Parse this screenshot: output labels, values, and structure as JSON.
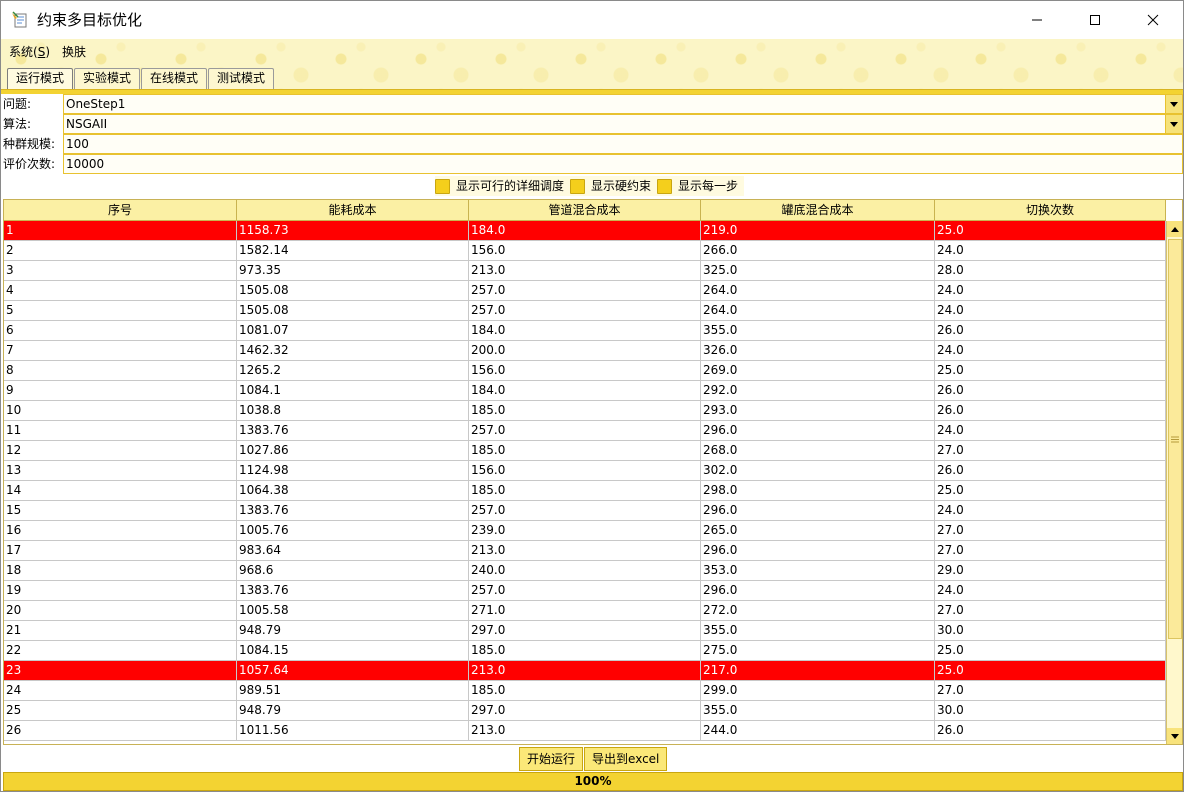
{
  "window": {
    "title": "约束多目标优化"
  },
  "menu": [
    {
      "label": "系统(",
      "mnemonic": "S",
      "suffix": ")"
    },
    {
      "label": "换肤"
    }
  ],
  "tabs": [
    "运行模式",
    "实验模式",
    "在线模式",
    "测试模式"
  ],
  "form": {
    "problem_label": "问题:",
    "problem_value": "OneStep1",
    "algorithm_label": "算法:",
    "algorithm_value": "NSGAII",
    "population_label": "种群规模:",
    "population_value": "100",
    "evaluations_label": "评价次数:",
    "evaluations_value": "10000"
  },
  "checkboxes": [
    "显示可行的详细调度",
    "显示硬约束",
    "显示每一步"
  ],
  "table": {
    "columns": [
      "序号",
      "能耗成本",
      "管道混合成本",
      "罐底混合成本",
      "切换次数"
    ],
    "rows": [
      {
        "cells": [
          "1",
          "1158.73",
          "184.0",
          "219.0",
          "25.0"
        ],
        "highlight": true
      },
      {
        "cells": [
          "2",
          "1582.14",
          "156.0",
          "266.0",
          "24.0"
        ]
      },
      {
        "cells": [
          "3",
          "973.35",
          "213.0",
          "325.0",
          "28.0"
        ]
      },
      {
        "cells": [
          "4",
          "1505.08",
          "257.0",
          "264.0",
          "24.0"
        ]
      },
      {
        "cells": [
          "5",
          "1505.08",
          "257.0",
          "264.0",
          "24.0"
        ]
      },
      {
        "cells": [
          "6",
          "1081.07",
          "184.0",
          "355.0",
          "26.0"
        ]
      },
      {
        "cells": [
          "7",
          "1462.32",
          "200.0",
          "326.0",
          "24.0"
        ]
      },
      {
        "cells": [
          "8",
          "1265.2",
          "156.0",
          "269.0",
          "25.0"
        ]
      },
      {
        "cells": [
          "9",
          "1084.1",
          "184.0",
          "292.0",
          "26.0"
        ]
      },
      {
        "cells": [
          "10",
          "1038.8",
          "185.0",
          "293.0",
          "26.0"
        ]
      },
      {
        "cells": [
          "11",
          "1383.76",
          "257.0",
          "296.0",
          "24.0"
        ]
      },
      {
        "cells": [
          "12",
          "1027.86",
          "185.0",
          "268.0",
          "27.0"
        ]
      },
      {
        "cells": [
          "13",
          "1124.98",
          "156.0",
          "302.0",
          "26.0"
        ]
      },
      {
        "cells": [
          "14",
          "1064.38",
          "185.0",
          "298.0",
          "25.0"
        ]
      },
      {
        "cells": [
          "15",
          "1383.76",
          "257.0",
          "296.0",
          "24.0"
        ]
      },
      {
        "cells": [
          "16",
          "1005.76",
          "239.0",
          "265.0",
          "27.0"
        ]
      },
      {
        "cells": [
          "17",
          "983.64",
          "213.0",
          "296.0",
          "27.0"
        ]
      },
      {
        "cells": [
          "18",
          "968.6",
          "240.0",
          "353.0",
          "29.0"
        ]
      },
      {
        "cells": [
          "19",
          "1383.76",
          "257.0",
          "296.0",
          "24.0"
        ]
      },
      {
        "cells": [
          "20",
          "1005.58",
          "271.0",
          "272.0",
          "27.0"
        ]
      },
      {
        "cells": [
          "21",
          "948.79",
          "297.0",
          "355.0",
          "30.0"
        ]
      },
      {
        "cells": [
          "22",
          "1084.15",
          "185.0",
          "275.0",
          "25.0"
        ]
      },
      {
        "cells": [
          "23",
          "1057.64",
          "213.0",
          "217.0",
          "25.0"
        ],
        "highlight": true
      },
      {
        "cells": [
          "24",
          "989.51",
          "185.0",
          "299.0",
          "27.0"
        ]
      },
      {
        "cells": [
          "25",
          "948.79",
          "297.0",
          "355.0",
          "30.0"
        ]
      },
      {
        "cells": [
          "26",
          "1011.56",
          "213.0",
          "244.0",
          "26.0"
        ]
      }
    ]
  },
  "buttons": {
    "run": "开始运行",
    "export": "导出到excel"
  },
  "progress": {
    "value": 1.0,
    "label": "100%"
  },
  "colors": {
    "accent": "#f3d332",
    "highlight_row": "#ff0000",
    "band": "#fbf5c6"
  }
}
